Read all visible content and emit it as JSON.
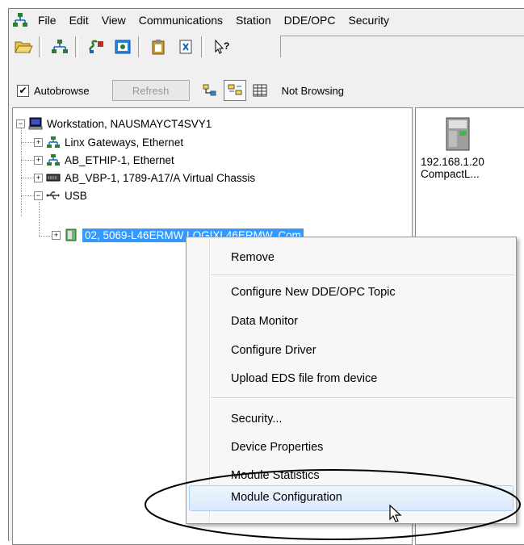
{
  "menubar": {
    "items": [
      "File",
      "Edit",
      "View",
      "Communications",
      "Station",
      "DDE/OPC",
      "Security"
    ]
  },
  "toolbar2": {
    "autobrowse_label": "Autobrowse",
    "autobrowse_checked": true,
    "refresh_label": "Refresh",
    "status": "Not Browsing"
  },
  "tree": {
    "root": "Workstation, NAUSMAYCT4SVY1",
    "children": [
      "Linx Gateways, Ethernet",
      "AB_ETHIP-1, Ethernet",
      "AB_VBP-1, 1789-A17/A Virtual Chassis",
      "USB"
    ],
    "usb_child": "02, 5069-L46ERMW LOGIXL46ERMW, Com"
  },
  "device_pane": {
    "address": "192.168.1.20",
    "name": "CompactL..."
  },
  "context_menu": {
    "items": [
      "Remove",
      "Configure New DDE/OPC Topic",
      "Data Monitor",
      "Configure Driver",
      "Upload EDS file from device",
      "Security...",
      "Device Properties",
      "Module Statistics",
      "Module Configuration"
    ],
    "highlighted": "Module Configuration"
  },
  "colors": {
    "selection": "#3399ff",
    "menu_highlight": "#dbeafb",
    "window_bg": "#f0f0f0"
  }
}
